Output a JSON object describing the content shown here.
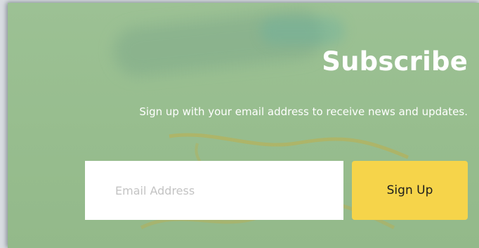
{
  "subscribe": {
    "title": "Subscribe",
    "subtitle": "Sign up with your email address to receive news and updates.",
    "email_placeholder": "Email Address",
    "email_value": "",
    "button_label": "Sign Up"
  },
  "colors": {
    "panel_background": "#9cc194",
    "button_background": "#f6d44a",
    "text": "#ffffff"
  }
}
